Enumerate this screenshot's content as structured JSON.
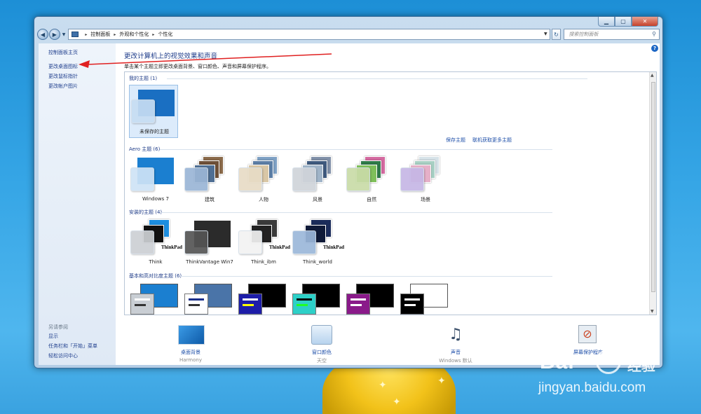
{
  "window": {
    "caption_buttons": [
      "minimize",
      "maximize",
      "close"
    ]
  },
  "address_bar": {
    "crumbs": [
      "控制面板",
      "外观和个性化",
      "个性化"
    ],
    "search_placeholder": "搜索控制面板"
  },
  "sidebar": {
    "links": [
      "控制面板主页",
      "更改桌面图标",
      "更改鼠标指针",
      "更改帐户图片"
    ],
    "see_also_header": "另请参阅",
    "see_also": [
      "显示",
      "任务栏和「开始」菜单",
      "轻松访问中心"
    ]
  },
  "main": {
    "title": "更改计算机上的视觉效果和声音",
    "description": "单击某个主题立即更改桌面背景、窗口颜色、声音和屏幕保护程序。",
    "help": "?"
  },
  "gallery": {
    "my_themes": {
      "header": "我的主题 (1)",
      "items": [
        {
          "name": "未保存的主题",
          "bg": "#1a6fc2",
          "swatch": "#c7ddf3"
        }
      ],
      "save_link": "保存主题",
      "online_link": "联机获取更多主题"
    },
    "aero": {
      "header": "Aero 主题 (6)",
      "items": [
        {
          "name": "Windows 7",
          "bg": "#1b7fd0",
          "swatch": "#cfe3f6"
        },
        {
          "name": "建筑",
          "bg": "#7d5a3c",
          "swatch": "#9bb6d6"
        },
        {
          "name": "人物",
          "bg": "#6f8fb0",
          "swatch": "#e8dcc6"
        },
        {
          "name": "风景",
          "bg": "#546a8a",
          "swatch": "#d0d4da"
        },
        {
          "name": "自然",
          "bg": "#3c8d56",
          "swatch": "#c9dca8"
        },
        {
          "name": "场景",
          "bg": "#b7cfd7",
          "swatch": "#c6b7e6"
        }
      ]
    },
    "installed": {
      "header": "安装的主题 (4)",
      "items": [
        {
          "name": "Think",
          "bg": "#1c8ee0",
          "swatch": "#cdd0d4"
        },
        {
          "name": "ThinkVantage Win7",
          "bg": "#2b2b2b",
          "swatch": "#555555"
        },
        {
          "name": "Think_ibm",
          "bg": "#3a3a3a",
          "swatch": "#f2f2f2"
        },
        {
          "name": "Think_world",
          "bg": "#1a2b5a",
          "swatch": "#9cb8da"
        }
      ],
      "brand": "ThinkPad"
    },
    "high_contrast": {
      "header": "基本和高对比度主题 (6)",
      "items": [
        {
          "bg": "#1b7fd0",
          "card": "#c9ced4",
          "bar": "#ffffff"
        },
        {
          "bg": "#4a74a8",
          "card": "#ffffff",
          "bar": "#1a2f8a"
        },
        {
          "bg": "#000000",
          "card": "#1d1da8",
          "bar": "#ffff00"
        },
        {
          "bg": "#000000",
          "card": "#2dd0c8",
          "bar": "#22ff22"
        },
        {
          "bg": "#000000",
          "card": "#8a1a8a",
          "bar": "#ffffff"
        },
        {
          "bg": "#ffffff",
          "card": "#000000",
          "bar": "#ffffff"
        }
      ]
    }
  },
  "settings": [
    {
      "label": "桌面背景",
      "value": "Harmony",
      "icon": "desktop-background-icon"
    },
    {
      "label": "窗口颜色",
      "value": "天空",
      "icon": "window-color-icon"
    },
    {
      "label": "声音",
      "value": "Windows 默认",
      "icon": "sound-icon"
    },
    {
      "label": "屏幕保护程序",
      "value": "",
      "icon": "screensaver-icon"
    }
  ],
  "watermark": {
    "brand": "Bai",
    "cn": "经验",
    "url": "jingyan.baidu.com"
  }
}
